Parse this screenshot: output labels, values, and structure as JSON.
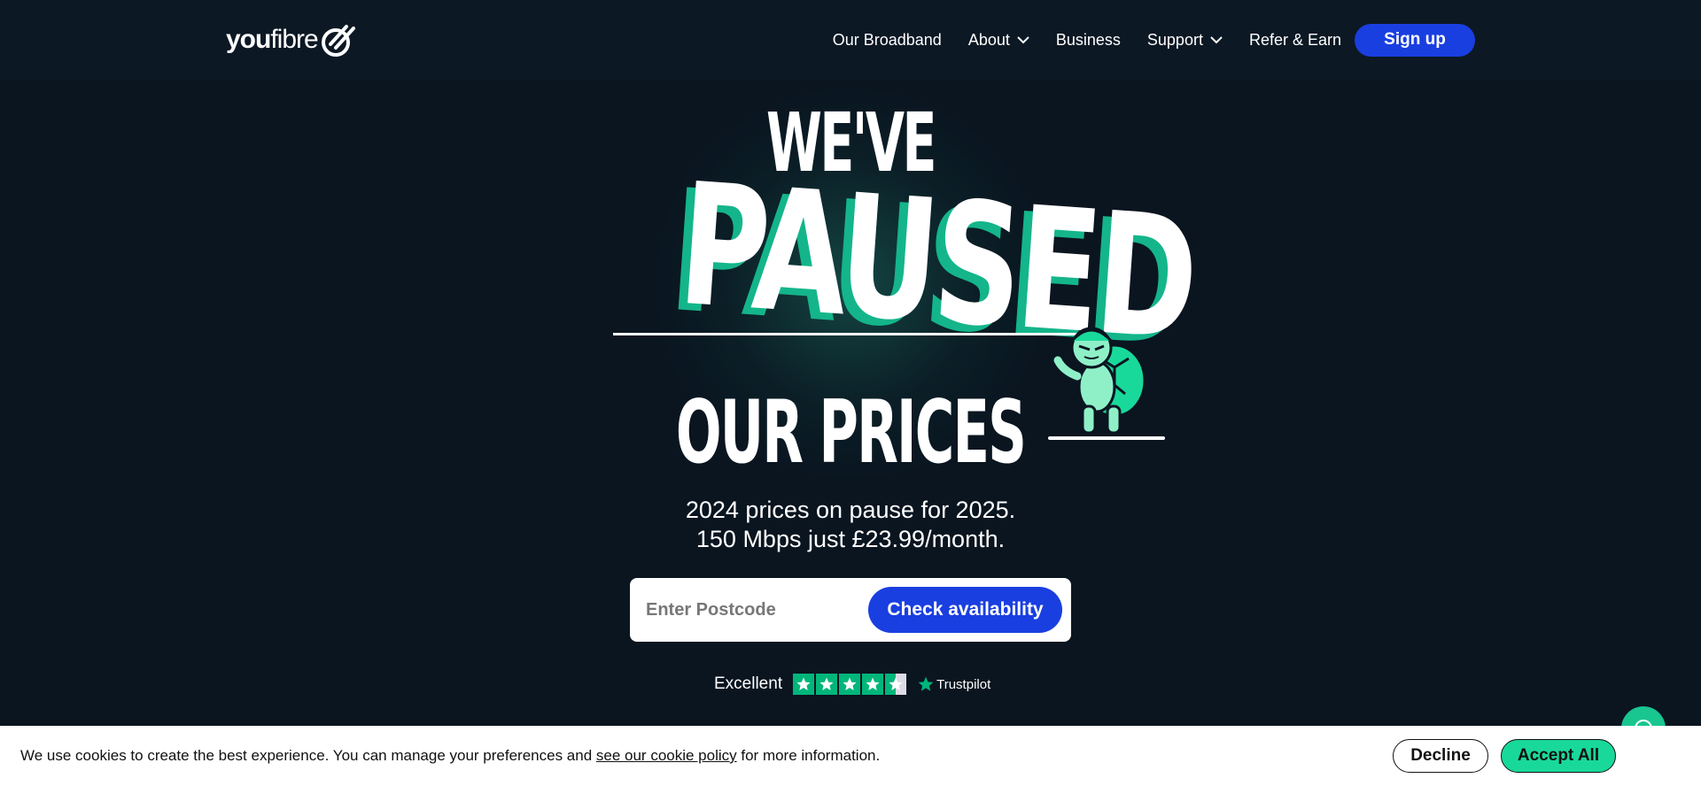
{
  "header": {
    "logo": {
      "part1": "you",
      "part2": "fibre"
    },
    "nav": [
      {
        "label": "Our Broadband",
        "has_dropdown": false
      },
      {
        "label": "About",
        "has_dropdown": true
      },
      {
        "label": "Business",
        "has_dropdown": false
      },
      {
        "label": "Support",
        "has_dropdown": true
      },
      {
        "label": "Refer & Earn",
        "has_dropdown": false
      }
    ],
    "signup_label": "Sign up"
  },
  "hero": {
    "line1": "WE'VE",
    "line2": "PAUSED",
    "line3": "OUR PRICES",
    "tagline_line1": "2024 prices on pause for 2025.",
    "tagline_line2": "150 Mbps just £23.99/month."
  },
  "search": {
    "placeholder": "Enter Postcode",
    "value": "",
    "button_label": "Check availability"
  },
  "trustpilot": {
    "rating_text": "Excellent",
    "stars": 4.5,
    "brand": "Trustpilot"
  },
  "cookie": {
    "text_before": "We use cookies to create the best experience. You can manage your preferences and ",
    "link_text": "see our cookie policy",
    "text_after": " for more information.",
    "decline_label": "Decline",
    "accept_label": "Accept All"
  },
  "colors": {
    "background": "#0a1520",
    "primary_button": "#1a3fe0",
    "accent_green": "#19d99a",
    "trustpilot_green": "#00b67a"
  },
  "icons": {
    "logo_mark": "youfibre-swoosh-icon",
    "dropdown": "chevron-down-icon",
    "trust_star": "star-icon",
    "mascot": "turtle-mascot",
    "chat": "chat-icon"
  }
}
